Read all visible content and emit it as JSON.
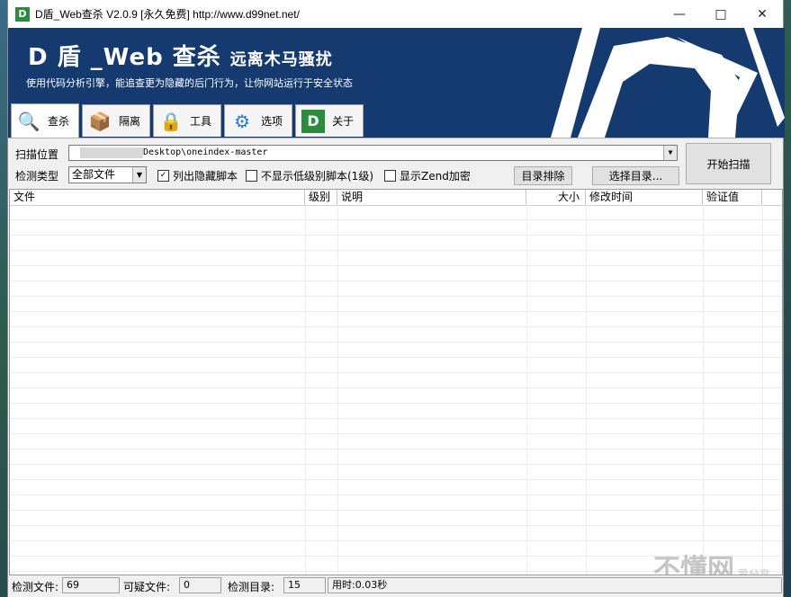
{
  "window": {
    "title": "D盾_Web查杀 V2.0.9 [永久免费] http://www.d99net.net/",
    "icon_text": "D"
  },
  "banner": {
    "title": "D 盾 _Web 查杀",
    "subtitle": "远离木马骚扰",
    "description": "使用代码分析引擎，能追查更为隐藏的后门行为，让你网站运行于安全状态",
    "logo_text": "D"
  },
  "tabs": [
    {
      "label": "查杀",
      "icon": "magnifier-icon",
      "glyph": "🔍"
    },
    {
      "label": "隔离",
      "icon": "box-icon",
      "glyph": "📦"
    },
    {
      "label": "工具",
      "icon": "lock-icon",
      "glyph": "🔒"
    },
    {
      "label": "选项",
      "icon": "gear-icon",
      "glyph": "⚙"
    },
    {
      "label": "关于",
      "icon": "d-logo-icon",
      "glyph": "D"
    }
  ],
  "scan": {
    "path_label": "扫描位置",
    "path_value": "Desktop\\oneindex-master",
    "type_label": "检测类型",
    "type_value": "全部文件",
    "chk_hidden": {
      "label": "列出隐藏脚本",
      "checked": "✓"
    },
    "chk_low": {
      "label": "不显示低级别脚本(1级)"
    },
    "chk_zend": {
      "label": "显示Zend加密"
    },
    "btn_exclude": "目录排除",
    "btn_choose": "选择目录...",
    "btn_start": "开始扫描"
  },
  "table": {
    "headers": [
      "文件",
      "级别",
      "说明",
      "大小",
      "修改时间",
      "验证值"
    ]
  },
  "status": {
    "files_label": "检测文件:",
    "files_value": "69",
    "suspect_label": "可疑文件:",
    "suspect_value": "0",
    "dirs_label": "检测目录:",
    "dirs_value": "15",
    "time_label": "用时:0.03秒"
  },
  "watermark": {
    "main": "不懂网",
    "side": "爱分享"
  }
}
